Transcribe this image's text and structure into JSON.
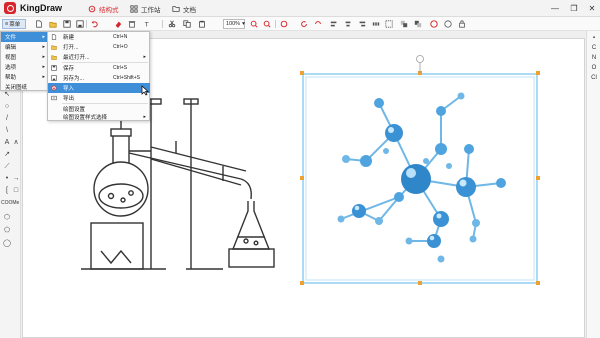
{
  "app": {
    "name": "KingDraw"
  },
  "nav_tabs": [
    {
      "label": "结构式",
      "active": true
    },
    {
      "label": "工作站",
      "active": false
    },
    {
      "label": "文档",
      "active": false
    }
  ],
  "window_controls": [
    "—",
    "❐",
    "✕"
  ],
  "toolbar": {
    "menu_label": "菜单",
    "zoom": "100%"
  },
  "main_menu": [
    {
      "label": "文件",
      "has_submenu": true,
      "active": true
    },
    {
      "label": "编辑",
      "has_submenu": true
    },
    {
      "label": "视图",
      "has_submenu": true
    },
    {
      "label": "选项",
      "has_submenu": true
    },
    {
      "label": "帮助",
      "has_submenu": true
    },
    {
      "label": "关闭图纸",
      "has_submenu": false
    }
  ],
  "file_menu": [
    {
      "label": "新建",
      "shortcut": "Ctrl+N",
      "icon": "new-file-icon"
    },
    {
      "label": "打开...",
      "shortcut": "Ctrl+O",
      "icon": "open-folder-icon"
    },
    {
      "label": "最近打开...",
      "shortcut": "",
      "icon": "recent-folder-icon",
      "has_submenu": true
    },
    {
      "label": "保存",
      "shortcut": "Ctrl+S",
      "icon": "save-icon"
    },
    {
      "label": "另存为...",
      "shortcut": "Ctrl+Shift+S",
      "icon": "save-as-icon"
    },
    {
      "label": "导入",
      "shortcut": "",
      "icon": "import-icon",
      "active": true
    },
    {
      "label": "导出",
      "shortcut": "",
      "icon": "export-icon"
    },
    {
      "label": "绘图设置",
      "shortcut": "",
      "icon": ""
    },
    {
      "label": "绘图设置样式选择",
      "shortcut": "",
      "icon": "",
      "has_submenu": true
    }
  ],
  "left_palette": {
    "label": "COOMe"
  },
  "right_panel": [
    "C",
    "N",
    "O",
    "Cl"
  ],
  "colors": {
    "accent": "#d6262b",
    "menu_highlight": "#3f8fd8",
    "selection": "#8ecdf0",
    "handle": "#f0a030"
  }
}
